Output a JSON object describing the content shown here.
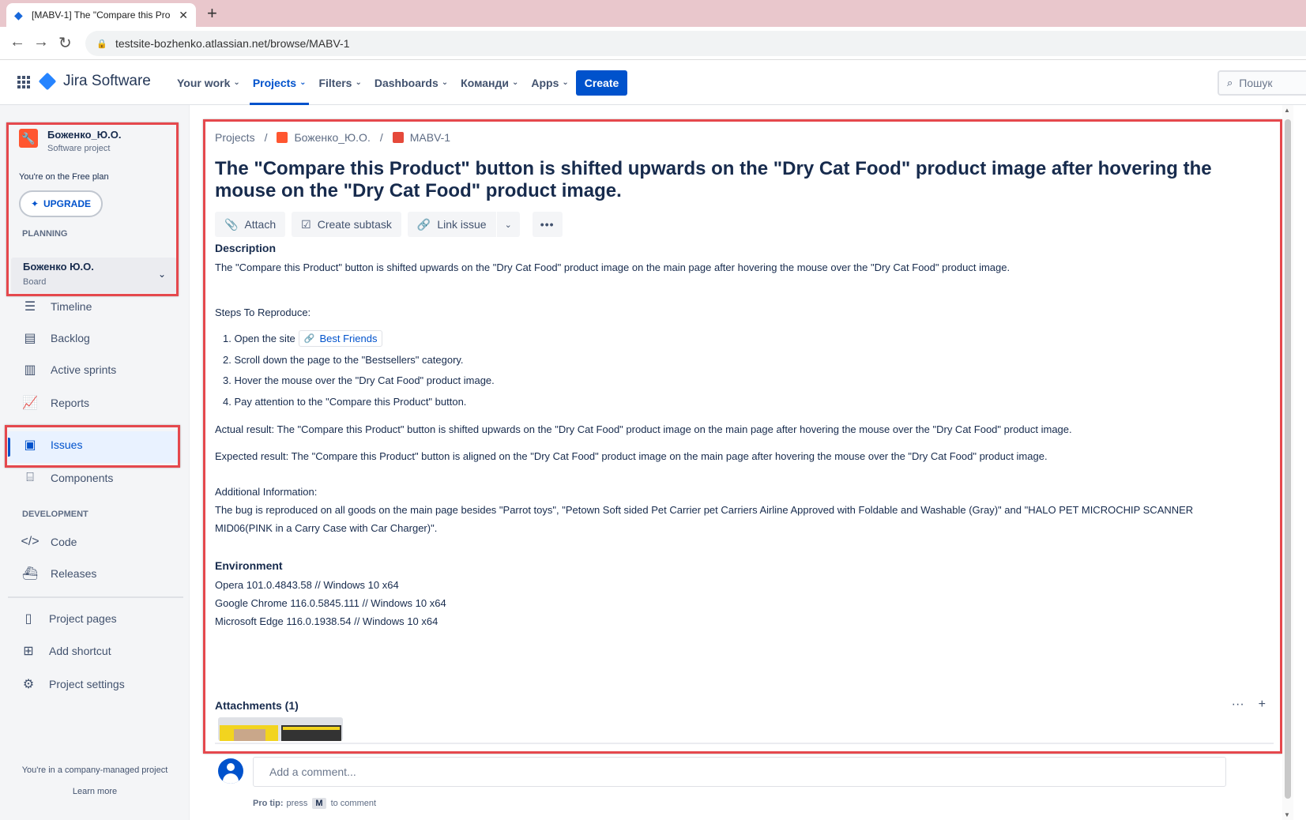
{
  "browser": {
    "tab_title": "[MABV-1] The \"Compare this Pro",
    "url": "testsite-bozhenko.atlassian.net/browse/MABV-1"
  },
  "header": {
    "logo": "Jira Software",
    "menu": [
      {
        "label": "Your work"
      },
      {
        "label": "Projects"
      },
      {
        "label": "Filters"
      },
      {
        "label": "Dashboards"
      },
      {
        "label": "Команди"
      },
      {
        "label": "Apps"
      }
    ],
    "create_label": "Create",
    "search_placeholder": "Пошук"
  },
  "sidebar": {
    "project_name": "Боженко_Ю.О.",
    "project_type": "Software project",
    "free_plan": "You're on the Free plan",
    "upgrade_label": "UPGRADE",
    "planning_heading": "PLANNING",
    "board_name": "Боженко Ю.О.",
    "board_sub": "Board",
    "planning_items": [
      "Timeline",
      "Backlog",
      "Active sprints",
      "Reports",
      "Issues",
      "Components"
    ],
    "development_heading": "DEVELOPMENT",
    "development_items": [
      "Code",
      "Releases"
    ],
    "other_items": [
      "Project pages",
      "Add shortcut",
      "Project settings"
    ],
    "footer_text": "You're in a company-managed project",
    "learn_more": "Learn more"
  },
  "issue": {
    "breadcrumbs": [
      "Projects",
      "Боженко_Ю.О.",
      "MABV-1"
    ],
    "title": "The \"Compare this Product\" button is shifted upwards on the \"Dry Cat Food\" product image after hovering the mouse on the \"Dry Cat Food\" product image.",
    "actions": {
      "attach": "Attach",
      "create_subtask": "Create subtask",
      "link_issue": "Link issue",
      "more": "•••"
    },
    "description_heading": "Description",
    "description_text": "The \"Compare this Product\" button is shifted upwards on the \"Dry Cat Food\" product image on the main page after hovering the mouse over the \"Dry Cat Food\" product image.",
    "steps_heading": "Steps To Reproduce:",
    "step1_prefix": "1. Open the site",
    "step1_link": "Best Friends",
    "step2": "2. Scroll down the page to the \"Bestsellers\" category.",
    "step3": "3. Hover the mouse over the \"Dry Cat Food\" product image.",
    "step4": "4. Pay attention to the \"Compare this Product\" button.",
    "actual_result": "Actual result: The \"Compare this Product\" button is shifted upwards on the \"Dry Cat Food\" product image on the main page after hovering the mouse over the \"Dry Cat Food\" product image.",
    "expected_result": "Expected result: The \"Compare this Product\" button is aligned on the \"Dry Cat Food\" product image on the main page after hovering the mouse over the \"Dry Cat Food\" product image.",
    "additional_heading": "Additional Information:",
    "additional_line1": "The bug is reproduced on all goods on the main page besides \"Parrot toys\", \"Petown Soft sided Pet Carrier pet Carriers Airline Approved with Foldable and Washable (Gray)\" and \"HALO PET MICROCHIP SCANNER",
    "additional_line2": "MID06(PINK in a Carry Case with Car Charger)\".",
    "environment_heading": "Environment",
    "env1": "Opera 101.0.4843.58 // Windows 10 x64",
    "env2": "Google Chrome 116.0.5845.111 // Windows 10 x64",
    "env3": "Microsoft Edge 116.0.1938.54 // Windows 10 x64",
    "attachments_heading": "Attachments (1)"
  },
  "comment": {
    "placeholder": "Add a comment...",
    "protip_label": "Pro tip:",
    "protip_press": "press",
    "protip_key": "M",
    "protip_suffix": "to comment"
  },
  "colors": {
    "accent": "#0052cc",
    "highlight_box": "#e5484d",
    "tab_strip": "#e9c7cc"
  }
}
